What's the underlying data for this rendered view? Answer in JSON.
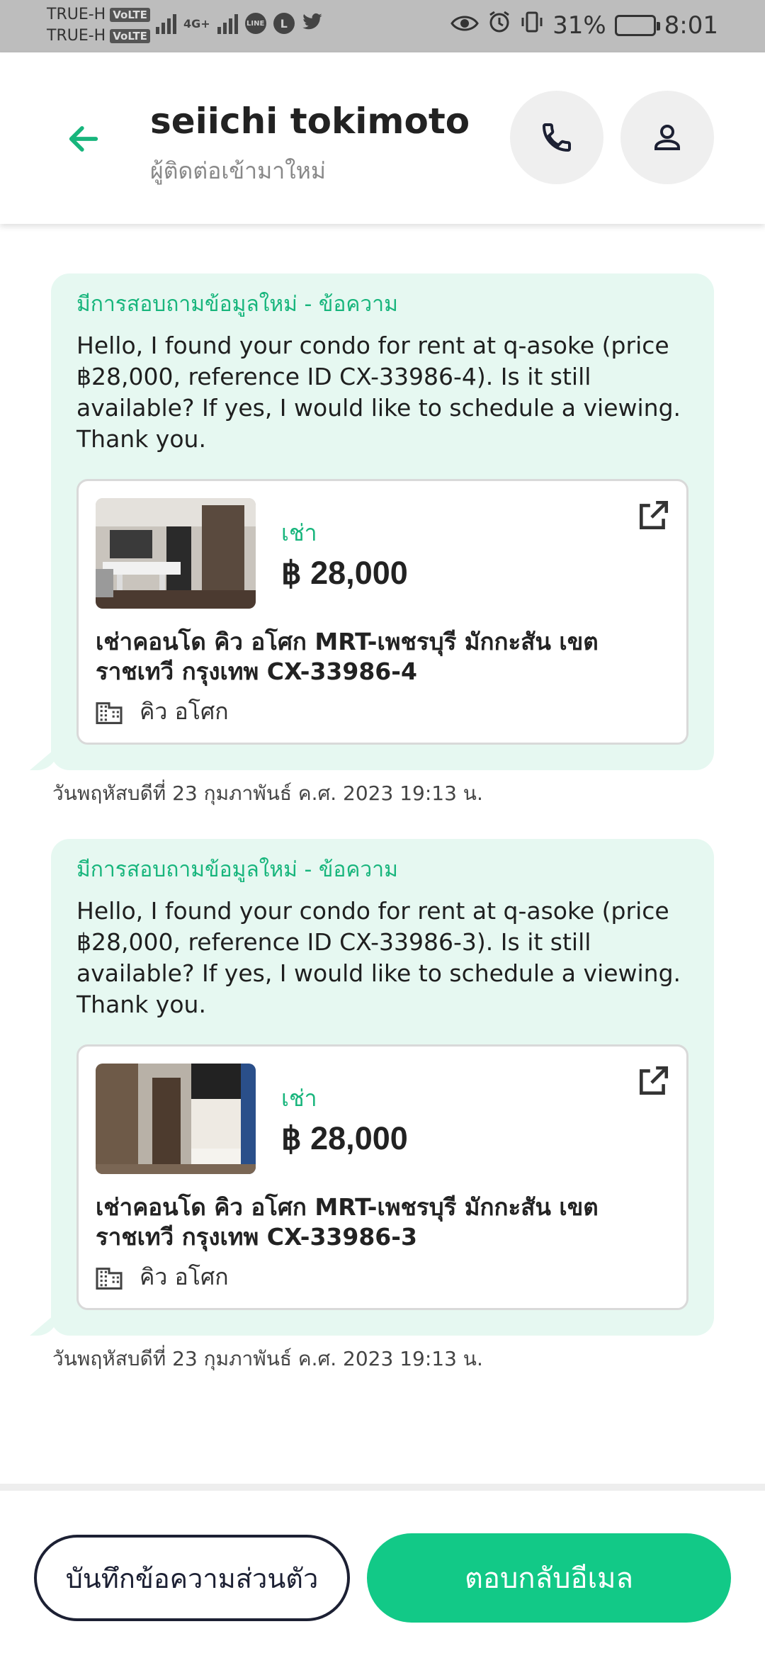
{
  "status_bar": {
    "carrier1": "TRUE-H",
    "carrier2": "TRUE-H",
    "volte": "VoLTE",
    "network": "4G+",
    "battery_pct": "31%",
    "battery_level": 0.31,
    "time": "8:01"
  },
  "header": {
    "name": "seiichi tokimoto",
    "subtitle": "ผู้ติดต่อเข้ามาใหม่"
  },
  "messages": [
    {
      "label": "มีการสอบถามข้อมูลใหม่ - ข้อความ",
      "text": "Hello, I found your condo for rent at q-asoke (price ฿28,000, reference ID CX-33986-4). Is it still available? If yes, I would like to schedule a viewing. Thank you.",
      "listing": {
        "type": "เช่า",
        "price": "฿ 28,000",
        "title": "เช่าคอนโด  คิว อโศก MRT-เพชรบุรี มักกะสัน เขตราชเทวี กรุงเทพ CX-33986-4",
        "building": "คิว อโศก"
      },
      "timestamp": "วันพฤหัสบดีที่ 23 กุมภาพันธ์ ค.ศ. 2023 19:13 น."
    },
    {
      "label": "มีการสอบถามข้อมูลใหม่ - ข้อความ",
      "text": "Hello, I found your condo for rent at q-asoke (price ฿28,000, reference ID CX-33986-3). Is it still available? If yes, I would like to schedule a viewing. Thank you.",
      "listing": {
        "type": "เช่า",
        "price": "฿ 28,000",
        "title": "เช่าคอนโด  คิว อโศก MRT-เพชรบุรี มักกะสัน เขตราชเทวี กรุงเทพ CX-33986-3",
        "building": "คิว อโศก"
      },
      "timestamp": "วันพฤหัสบดีที่ 23 กุมภาพันธ์ ค.ศ. 2023 19:13 น."
    }
  ],
  "actions": {
    "note_label": "บันทึกข้อความส่วนตัว",
    "reply_label": "ตอบกลับอีเมล"
  },
  "colors": {
    "accent": "#12c987",
    "card_bg": "#e6f8f1"
  }
}
